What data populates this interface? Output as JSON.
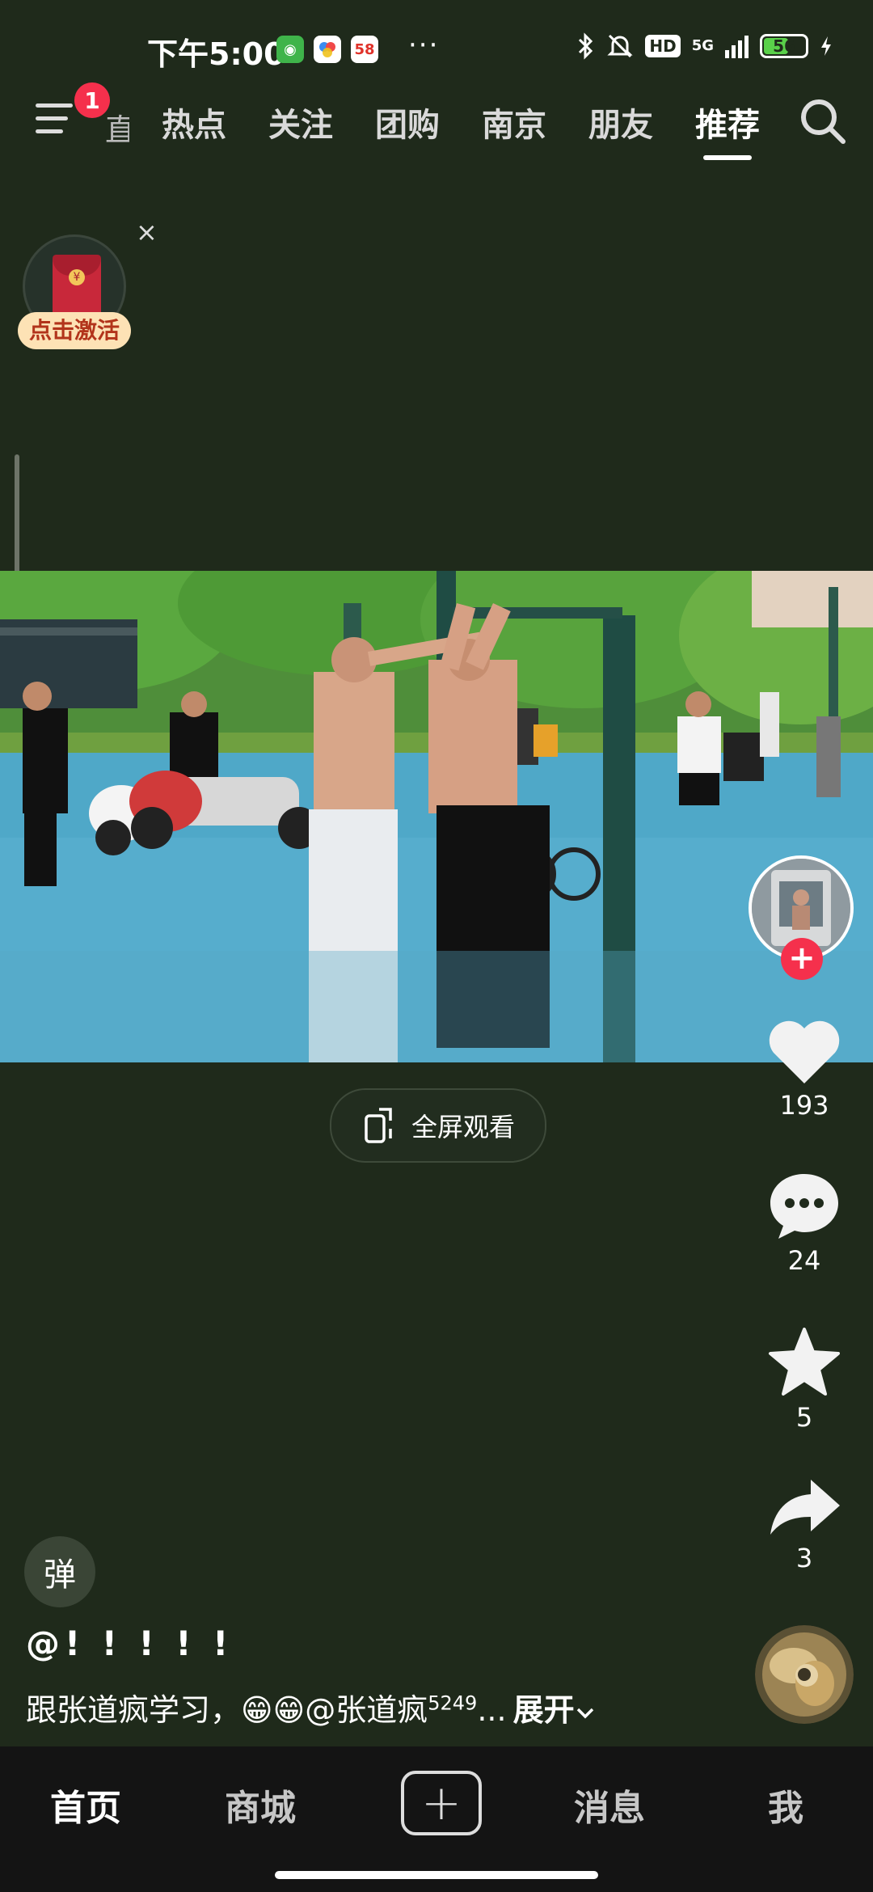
{
  "status_bar": {
    "time": "下午5:00",
    "more": "···",
    "network": "5G",
    "hd": "HD",
    "battery": "56"
  },
  "top_nav": {
    "notification_count": "1",
    "partial_tab": "直",
    "tabs": [
      "热点",
      "关注",
      "团购",
      "南京",
      "朋友",
      "推荐"
    ],
    "active_tab": "推荐"
  },
  "red_packet": {
    "label": "点击激活",
    "close": "×"
  },
  "actions": {
    "likes": "193",
    "comments": "24",
    "favorites": "5",
    "shares": "3"
  },
  "fullscreen": {
    "label": "全屏观看"
  },
  "danmu": {
    "label": "弹"
  },
  "caption": {
    "title": "@! ! ! ! !",
    "desc_text": "跟张道疯学习，😁😁@张道疯",
    "desc_sup": "5249",
    "desc_ellipsis": "...",
    "expand": "展开"
  },
  "bottom_nav": {
    "home": "首页",
    "mall": "商城",
    "create": "+",
    "messages": "消息",
    "me": "我"
  },
  "colors": {
    "background": "#1f2a1b",
    "accent_red": "#f5304c",
    "battery_green": "#5ad04a"
  }
}
